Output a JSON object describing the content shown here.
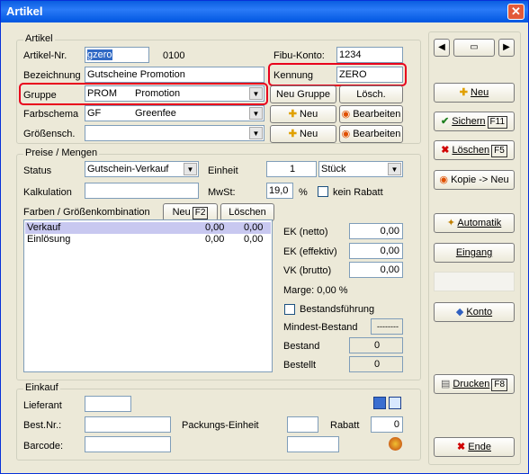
{
  "window": {
    "title": "Artikel",
    "close": "✕"
  },
  "artikel": {
    "group_title": "Artikel",
    "artikelnr_label": "Artikel-Nr.",
    "artikelnr_value": "gzero",
    "artikelnr_suffix": "0100",
    "fibu_label": "Fibu-Konto:",
    "fibu_value": "1234",
    "bezeichnung_label": "Bezeichnung",
    "bezeichnung_value": "Gutscheine Promotion",
    "kennung_label": "Kennung",
    "kennung_value": "ZERO",
    "gruppe_label": "Gruppe",
    "gruppe_code": "PROM",
    "gruppe_name": "Promotion",
    "neu_gruppe": "Neu Gruppe",
    "losch": "Lösch.",
    "farbschema_label": "Farbschema",
    "farbschema_code": "GF",
    "farbschema_name": "Greenfee",
    "neu": "Neu",
    "bearbeiten": "Bearbeiten",
    "groessensch_label": "Größensch."
  },
  "preise": {
    "group_title": "Preise / Mengen",
    "status_label": "Status",
    "status_value": "Gutschein-Verkauf",
    "einheit_label": "Einheit",
    "einheit_qty": "1",
    "einheit_value": "Stück",
    "kalkulation_label": "Kalkulation",
    "mwst_label": "MwSt:",
    "mwst_value": "19,0",
    "percent": "%",
    "kein_rabatt": "kein Rabatt",
    "farben_label": "Farben / Größenkombination",
    "neu_btn": "Neu",
    "neu_key": "F2",
    "loeschen_btn": "Löschen",
    "rows": [
      {
        "name": "Verkauf",
        "v1": "0,00",
        "v2": "0,00"
      },
      {
        "name": "Einlösung",
        "v1": "0,00",
        "v2": "0,00"
      }
    ],
    "ek_netto_label": "EK (netto)",
    "ek_netto": "0,00",
    "ek_eff_label": "EK (effektiv)",
    "ek_eff": "0,00",
    "vk_label": "VK (brutto)",
    "vk": "0,00",
    "marge": "Marge: 0,00 %",
    "bestandsfuehrung": "Bestandsführung",
    "mindest_label": "Mindest-Bestand",
    "mindest_value": "--------",
    "bestand_label": "Bestand",
    "bestand_value": "0",
    "bestellt_label": "Bestellt",
    "bestellt_value": "0"
  },
  "einkauf": {
    "group_title": "Einkauf",
    "lieferant_label": "Lieferant",
    "bestnr_label": "Best.Nr.:",
    "packungs_label": "Packungs-Einheit",
    "rabatt_label": "Rabatt",
    "rabatt_value": "0",
    "barcode_label": "Barcode:"
  },
  "sidebar": {
    "neu": "Neu",
    "sichern": "Sichern",
    "sichern_key": "F11",
    "loeschen": "Löschen",
    "loeschen_key": "F5",
    "kopie": "Kopie -> Neu",
    "automatik": "Automatik",
    "eingang": "Eingang",
    "konto": "Konto",
    "drucken": "Drucken",
    "drucken_key": "F8",
    "ende": "Ende"
  },
  "colors": {
    "highlight": "#e8001c",
    "title_bar": "#0a5ee0",
    "selection": "#c8c8f0"
  }
}
